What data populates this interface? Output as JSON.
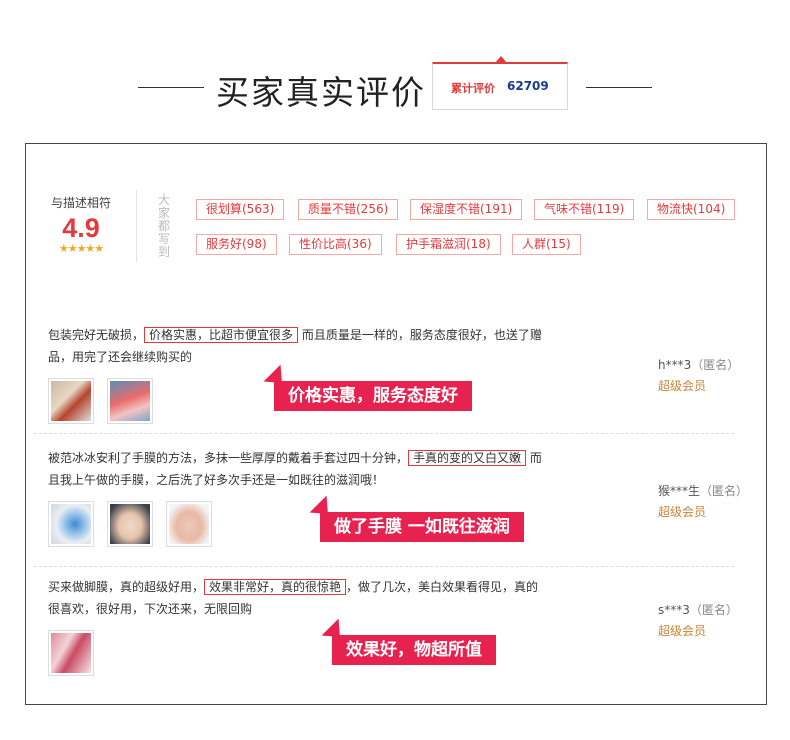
{
  "header": {
    "title": "买家真实评价",
    "count_label": "累计评价",
    "count_value": "62709"
  },
  "summary": {
    "score_label": "与描述相符",
    "score": "4.9",
    "stars": "★★★★★",
    "tags_label": "大家都写到",
    "tags": [
      "很划算(563)",
      "质量不错(256)",
      "保湿度不错(191)",
      "气味不错(119)",
      "物流快(104)",
      "服务好(98)",
      "性价比高(36)",
      "护手霜滋润(18)",
      "人群(15)"
    ]
  },
  "reviews": [
    {
      "pre": "包装完好无破损，",
      "highlight": "价格实惠，比超市便宜很多",
      "post": "而且质量是一样的，服务态度很好，也送了赠品，用完了还会继续购买的",
      "callout": "价格实惠，服务态度好",
      "user": "h***3",
      "anon": "（匿名）",
      "level": "超级会员"
    },
    {
      "pre": "被范冰冰安利了手膜的方法，多抹一些厚厚的戴着手套过四十分钟，",
      "highlight": "手真的变的又白又嫩",
      "post": "而且我上午做的手膜，之后洗了好多次手还是一如既往的滋润哦！",
      "callout": "做了手膜 一如既往滋润",
      "user": "猴***生",
      "anon": "（匿名）",
      "level": "超级会员"
    },
    {
      "pre": "买来做脚膜，真的超级好用，",
      "highlight": "效果非常好，真的很惊艳",
      "post": "，做了几次，美白效果看得见，真的很喜欢，很好用，下次还来，无限回购",
      "callout": "效果好，物超所值",
      "user": "s***3",
      "anon": "（匿名）",
      "level": "超级会员"
    }
  ]
}
